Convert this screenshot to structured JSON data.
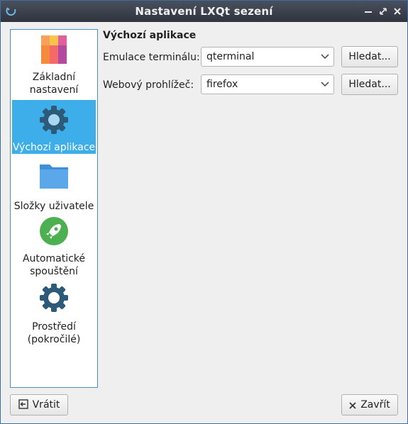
{
  "window": {
    "title": "Nastavení LXQt sezení"
  },
  "sidebar": {
    "items": [
      {
        "label_lines": [
          "Základní",
          "nastavení"
        ],
        "icon": "preferences-desktop-icon"
      },
      {
        "label_lines": [
          "Výchozí aplikace"
        ],
        "icon": "gear-icon",
        "selected": true
      },
      {
        "label_lines": [
          "Složky uživatele"
        ],
        "icon": "folder-icon"
      },
      {
        "label_lines": [
          "Automatické",
          "spouštění"
        ],
        "icon": "rocket-icon"
      },
      {
        "label_lines": [
          "Prostředí",
          "(pokročilé)"
        ],
        "icon": "gear-icon"
      }
    ]
  },
  "main": {
    "heading": "Výchozí aplikace",
    "terminal": {
      "label": "Emulace terminálu:",
      "value": "qterminal",
      "browse": "Hledat..."
    },
    "browser": {
      "label": "Webový prohlížeč:",
      "value": "firefox",
      "browse": "Hledat..."
    }
  },
  "footer": {
    "reset": "Vrátit",
    "close": "Zavřít"
  },
  "colors": {
    "accent": "#3daee9",
    "titlebar": "#2f343f"
  }
}
